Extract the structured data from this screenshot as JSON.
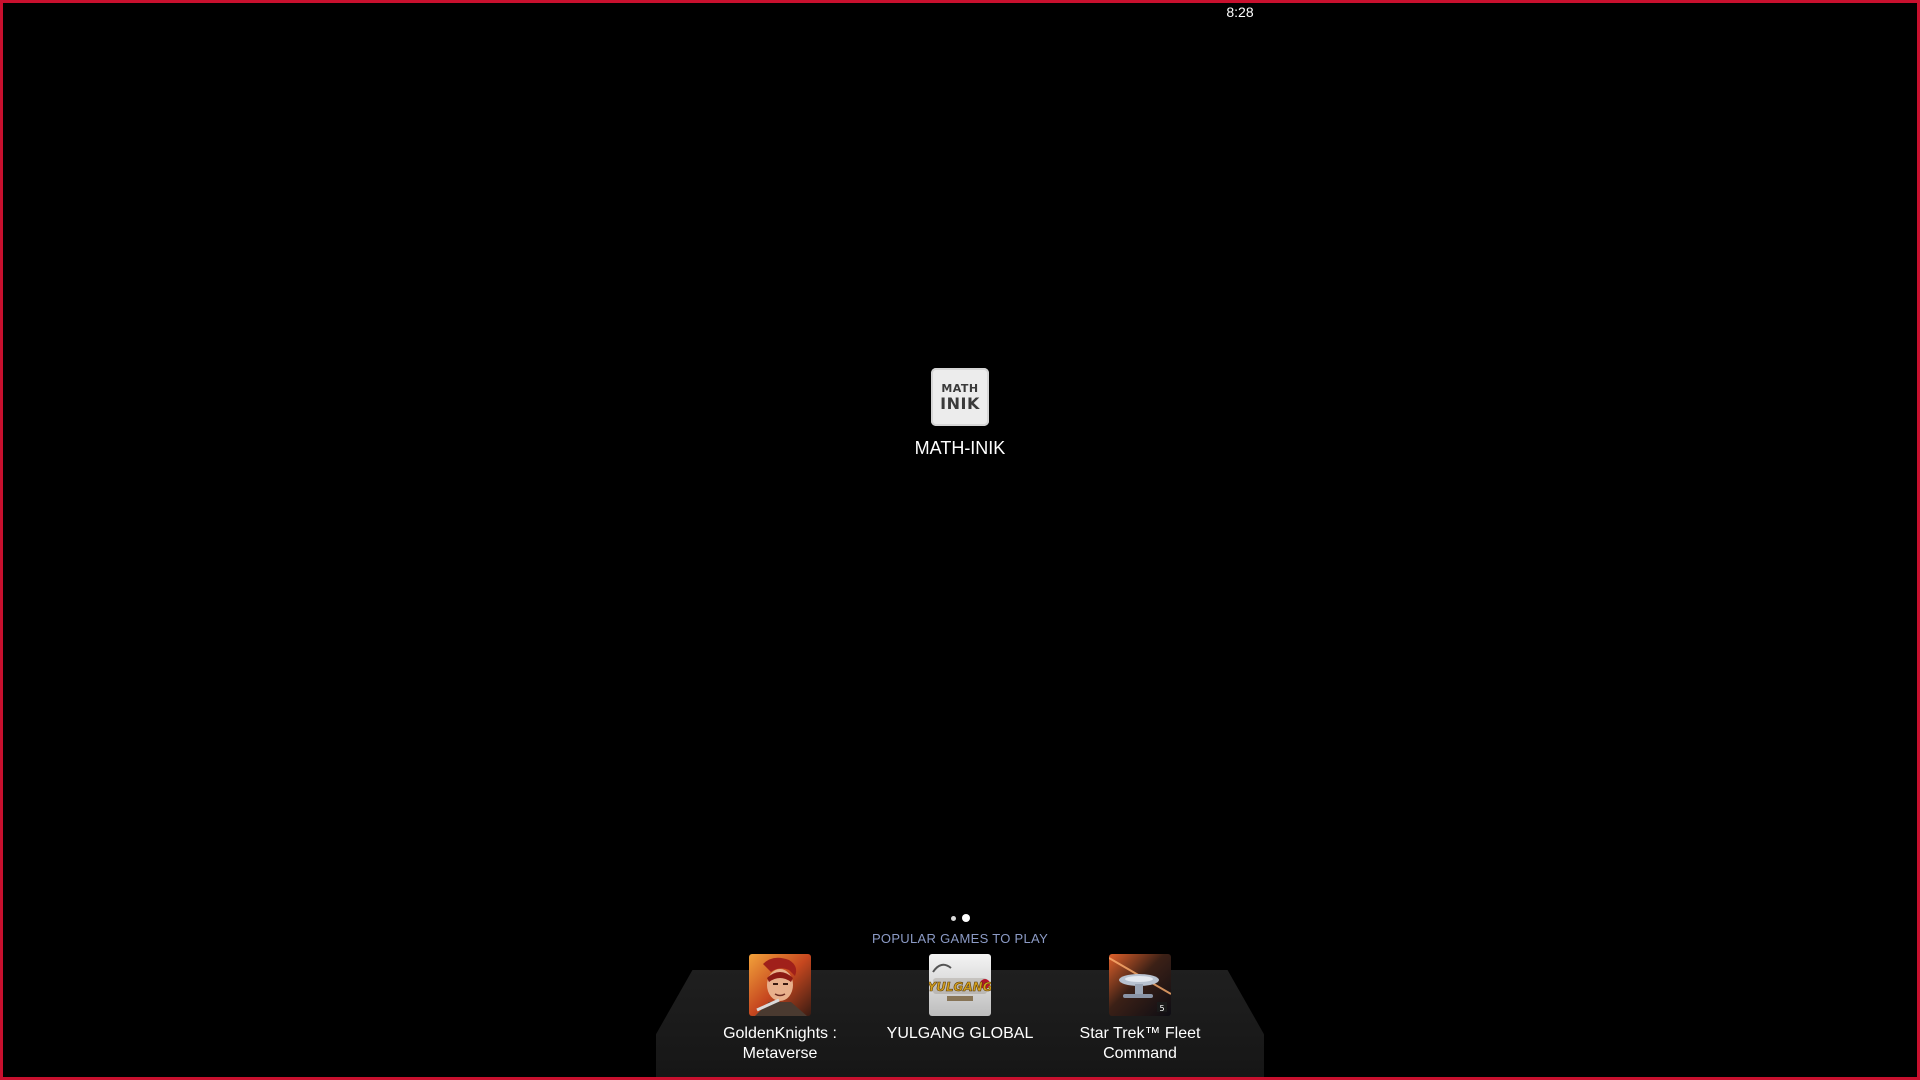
{
  "status_bar": {
    "time": "8:28"
  },
  "home": {
    "apps": [
      {
        "name": "MATH-INIK",
        "icon": "math-inik-app-icon",
        "icon_text_line1": "MATH",
        "icon_text_line2": "INIK"
      }
    ],
    "page_indicator": {
      "pages": 2,
      "current_page": 2
    }
  },
  "dock": {
    "title": "POPULAR GAMES TO PLAY",
    "games": [
      {
        "label": "GoldenKnights : Metaverse",
        "icon": "goldenknights-game-icon"
      },
      {
        "label": "YULGANG GLOBAL",
        "icon": "yulgang-game-icon",
        "icon_text": "YULGANG"
      },
      {
        "label": "Star Trek™ Fleet Command",
        "icon": "star-trek-game-icon"
      }
    ]
  },
  "colors": {
    "background": "#000000",
    "frame_border": "#c8102e",
    "dock_title": "#8c9bc6",
    "dock_background": "#1a1a1a"
  }
}
